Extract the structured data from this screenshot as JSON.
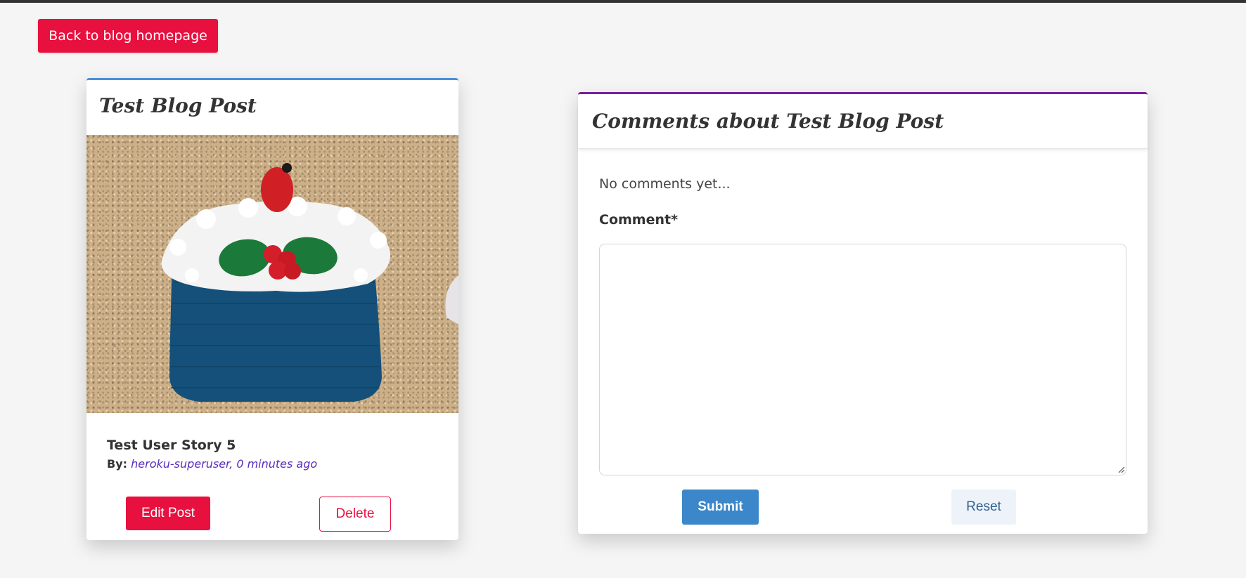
{
  "nav": {
    "back_label": "Back to blog homepage"
  },
  "post": {
    "title": "Test Blog Post",
    "image_alt": "Knitted Christmas pudding tea cosy with holly leaves and berry",
    "story_title": "Test User Story 5",
    "by_label": "By:",
    "author_time": "heroku-superuser, 0 minutes ago",
    "edit_label": "Edit Post",
    "delete_label": "Delete"
  },
  "comments": {
    "title": "Comments about Test Blog Post",
    "empty_text": "No comments yet...",
    "field_label": "Comment*",
    "field_value": "",
    "submit_label": "Submit",
    "reset_label": "Reset"
  },
  "colors": {
    "accent_red": "#e8103f",
    "post_card_border": "#4a90d9",
    "comments_card_border": "#7b1fa2",
    "submit_blue": "#3b87c9",
    "author_purple": "#5b2bbd"
  }
}
